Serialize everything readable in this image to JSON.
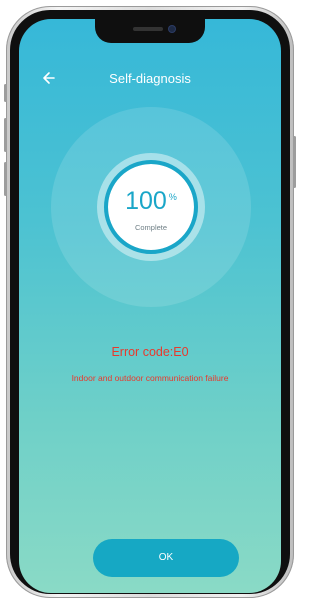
{
  "header": {
    "title": "Self-diagnosis",
    "back_icon": "back-arrow-icon"
  },
  "progress": {
    "value": "100",
    "unit": "%",
    "status": "Complete",
    "fraction": 1.0
  },
  "error": {
    "code": "Error code:E0",
    "description": "Indoor and outdoor communication failure"
  },
  "actions": {
    "ok_label": "OK"
  },
  "colors": {
    "accent": "#16a8c4",
    "ring": "#1aa6c8",
    "error": "#e8392c",
    "background_top": "#36b8d8",
    "background_bottom": "#8adac6"
  }
}
